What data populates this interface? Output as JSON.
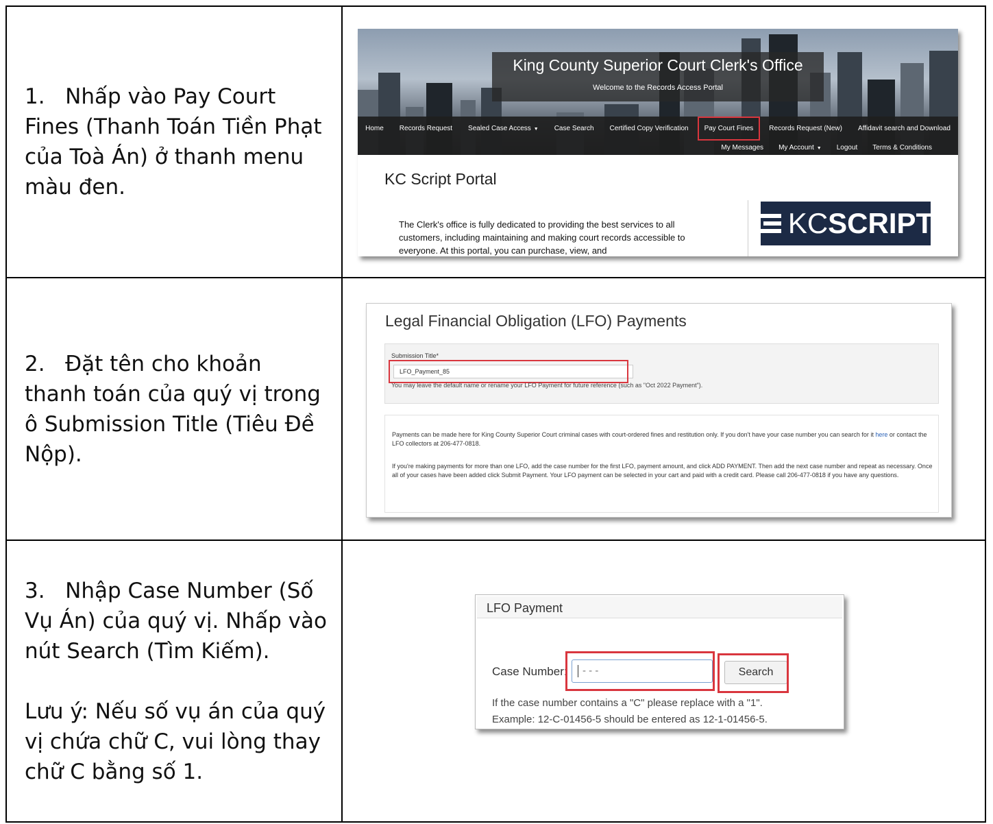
{
  "steps": [
    {
      "instruction": "1.   Nhấp vào Pay Court Fines (Thanh Toán Tiền Phạt của Toà Án) ở thanh menu màu đen."
    },
    {
      "instruction": "2.   Đặt tên cho khoản thanh toán của quý vị trong ô Submission Title (Tiêu Đề Nộp)."
    },
    {
      "instruction": "3.   Nhập Case Number (Số Vụ Án) của quý vị. Nhấp vào nút Search (Tìm Kiếm).",
      "note": "Lưu ý: Nếu số vụ án của quý vị chứa chữ C, vui lòng thay chữ C bằng số 1."
    }
  ],
  "screenshot1": {
    "site_title": "King County Superior Court Clerk's Office",
    "site_subtitle": "Welcome to the Records Access Portal",
    "nav_row1": [
      "Home",
      "Records Request",
      "Sealed Case Access",
      "Case Search",
      "Certified Copy Verification",
      "Pay Court Fines",
      "Records Request (New)",
      "Affidavit search and Download"
    ],
    "nav_row2": [
      "My Messages",
      "My Account",
      "Logout",
      "Terms & Conditions"
    ],
    "highlighted_item": "Pay Court Fines",
    "portal_title": "KC Script Portal",
    "portal_text": "The Clerk's office is fully dedicated to providing the best services to all customers, including maintaining and making court records accessible to everyone. At this portal, you can purchase, view, and",
    "logo_part1": "KC",
    "logo_part2": "SCRIPT"
  },
  "screenshot2": {
    "heading": "Legal Financial Obligation (LFO) Payments",
    "submission_label": "Submission Title*",
    "submission_value": "LFO_Payment_85",
    "submission_help": "You may leave the default name or rename your LFO Payment for future reference (such as \"Oct 2022 Payment\").",
    "info1_before_link": "Payments can be made here for King County Superior Court criminal cases with court-ordered fines and restitution only. If you don't have your case number you can search for it ",
    "info1_link": "here",
    "info1_after_link": " or contact the LFO collectors at 206-477-0818.",
    "info2": "If you're making payments for more than one LFO, add the case number for the first LFO, payment amount, and click ADD PAYMENT. Then add the next case number and repeat as necessary. Once all of your cases have been added click Submit Payment. Your LFO payment can be selected in your cart and paid with a credit card. Please call 206-477-0818 if you have any questions."
  },
  "screenshot3": {
    "panel_title": "LFO Payment",
    "case_label": "Case Number:",
    "case_value": "- -   -",
    "search_button": "Search",
    "hint_line1": "If the case number contains a \"C\" please replace with a \"1\".",
    "hint_line2": "Example: 12-C-01456-5 should be entered as 12-1-01456-5."
  },
  "colors": {
    "highlight": "#d9363e",
    "navbar": "#1e1e1e",
    "logo_bg": "#1c2a45",
    "link": "#2a62b8"
  }
}
